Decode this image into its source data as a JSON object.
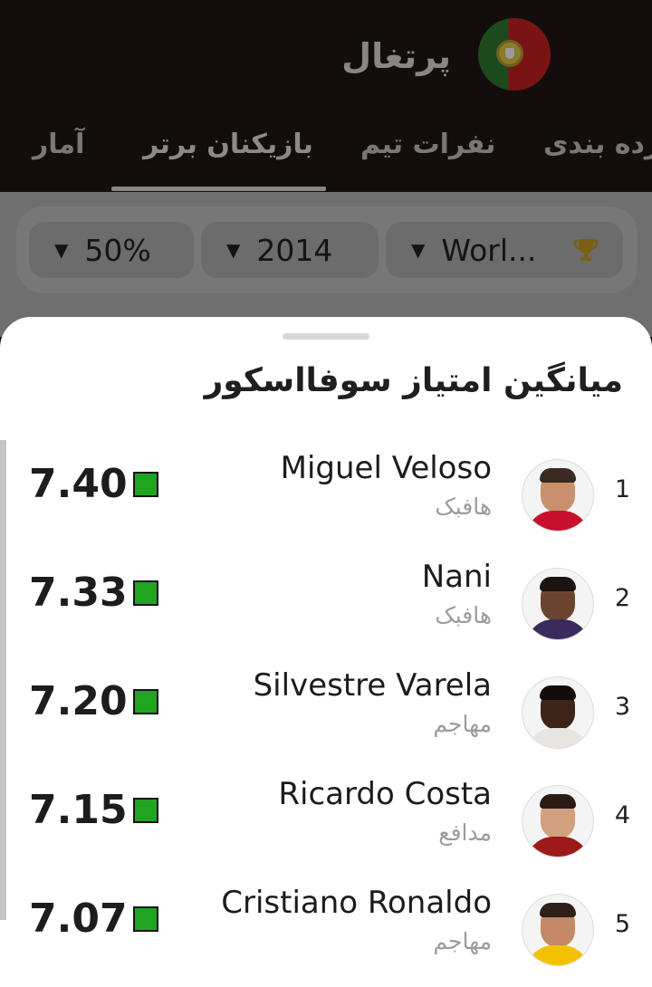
{
  "header": {
    "country": "پرتغال",
    "tabs": {
      "standings": "رده بندی",
      "squad": "نفرات تیم",
      "top_players": "بازیکنان برتر",
      "stats": "آمار"
    }
  },
  "filters": {
    "percent": "50%",
    "year": "2014",
    "competition": "Worl..."
  },
  "sheet": {
    "title": "میانگین امتیاز سوفااسکور"
  },
  "players": [
    {
      "rank": "1",
      "name": "Miguel Veloso",
      "position": "هافبک",
      "rating": "7.40"
    },
    {
      "rank": "2",
      "name": "Nani",
      "position": "هافبک",
      "rating": "7.33"
    },
    {
      "rank": "3",
      "name": "Silvestre Varela",
      "position": "مهاجم",
      "rating": "7.20"
    },
    {
      "rank": "4",
      "name": "Ricardo Costa",
      "position": "مدافع",
      "rating": "7.15"
    },
    {
      "rank": "5",
      "name": "Cristiano Ronaldo",
      "position": "مهاجم",
      "rating": "7.07"
    }
  ],
  "colors": {
    "rating_badge": "#1fa51f",
    "header_bg": "#130e0d",
    "sheet_bg": "#ffffff"
  }
}
